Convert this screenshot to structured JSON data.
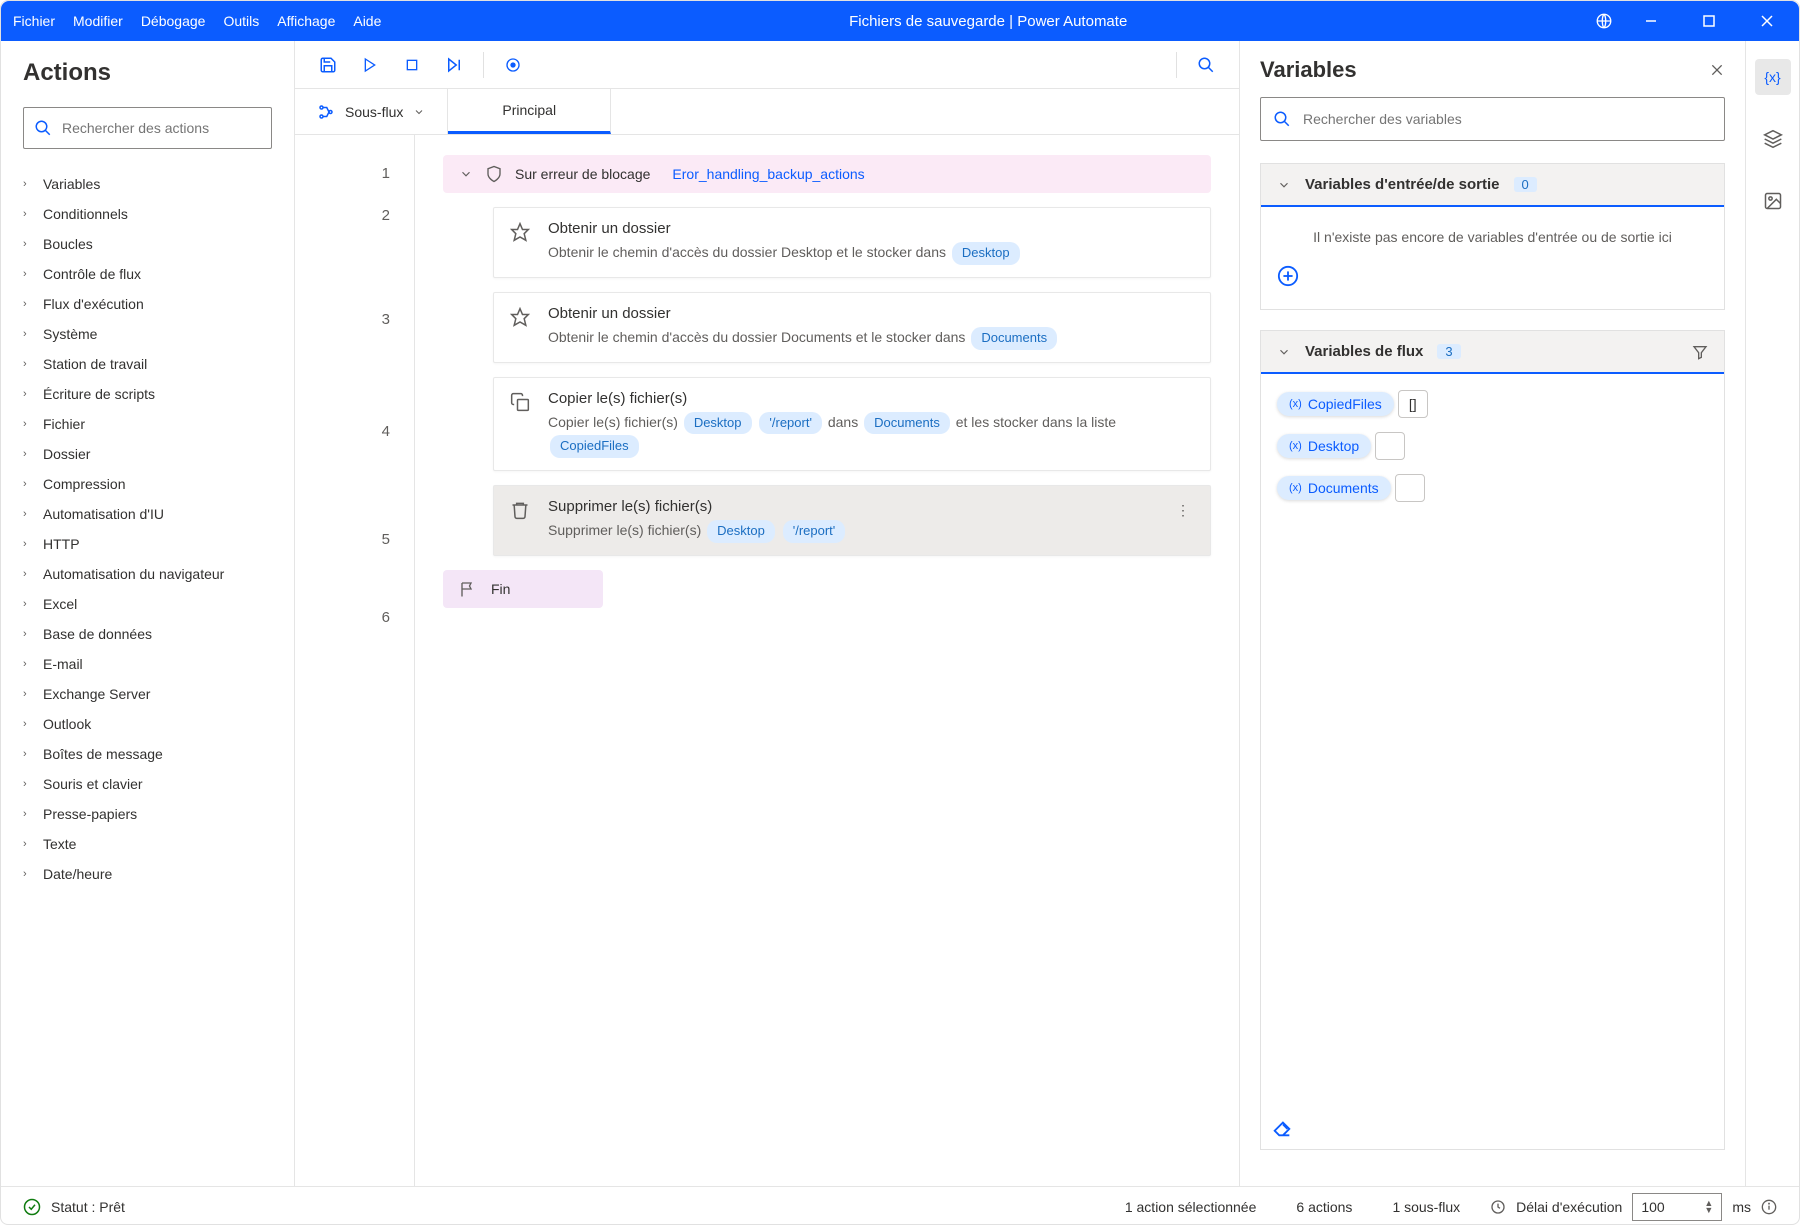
{
  "titlebar": {
    "menu": [
      "Fichier",
      "Modifier",
      "Débogage",
      "Outils",
      "Affichage",
      "Aide"
    ],
    "title": "Fichiers de sauvegarde | Power Automate"
  },
  "actions": {
    "header": "Actions",
    "search_placeholder": "Rechercher des actions",
    "items": [
      "Variables",
      "Conditionnels",
      "Boucles",
      "Contrôle de flux",
      "Flux d'exécution",
      "Système",
      "Station de travail",
      "Écriture de scripts",
      "Fichier",
      "Dossier",
      "Compression",
      "Automatisation d'IU",
      "HTTP",
      "Automatisation du navigateur",
      "Excel",
      "Base de données",
      "E-mail",
      "Exchange Server",
      "Outlook",
      "Boîtes de message",
      "Souris et clavier",
      "Presse-papiers",
      "Texte",
      "Date/heure"
    ]
  },
  "subflow_label": "Sous-flux",
  "tab_main": "Principal",
  "flow": {
    "block_title": "Sur erreur de blocage",
    "block_link": "Eror_handling_backup_actions",
    "end_label": "Fin",
    "actions": [
      {
        "title": "Obtenir un dossier",
        "desc_pre": "Obtenir le chemin d'accès du dossier Desktop et le stocker dans",
        "chips": [
          "Desktop"
        ],
        "icon": "star"
      },
      {
        "title": "Obtenir un dossier",
        "desc_pre": "Obtenir le chemin d'accès du dossier Documents et le stocker dans",
        "chips": [
          "Documents"
        ],
        "icon": "star"
      },
      {
        "title": "Copier le(s) fichier(s)",
        "desc_pre": "Copier le(s) fichier(s)",
        "chips": [
          "Desktop",
          "'/report'"
        ],
        "mid": "dans",
        "chips2": [
          "Documents"
        ],
        "tail": "et les stocker dans la liste",
        "chips3": [
          "CopiedFiles"
        ],
        "icon": "copy"
      },
      {
        "title": "Supprimer le(s) fichier(s)",
        "desc_pre": "Supprimer le(s) fichier(s)",
        "chips": [
          "Desktop",
          "'/report'"
        ],
        "icon": "trash",
        "selected": true
      }
    ],
    "line_numbers": [
      "1",
      "2",
      "3",
      "4",
      "5",
      "6"
    ]
  },
  "variables": {
    "header": "Variables",
    "search_placeholder": "Rechercher des variables",
    "io_title": "Variables d'entrée/de sortie",
    "io_count": "0",
    "io_empty": "Il n'existe pas encore de variables d'entrée ou de sortie ici",
    "flow_title": "Variables de flux",
    "flow_count": "3",
    "flow_vars": [
      {
        "name": "CopiedFiles",
        "val": "[]"
      },
      {
        "name": "Desktop",
        "val": ""
      },
      {
        "name": "Documents",
        "val": ""
      }
    ]
  },
  "status": {
    "label": "Statut : Prêt",
    "selected": "1 action sélectionnée",
    "actions": "6 actions",
    "subflows": "1 sous-flux",
    "delay_label": "Délai d'exécution",
    "delay_value": "100",
    "delay_unit": "ms"
  }
}
